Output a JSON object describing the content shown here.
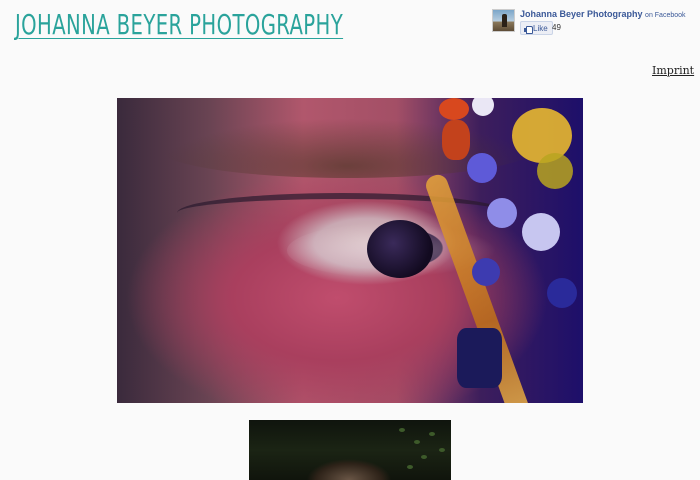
{
  "header": {
    "site_title": "Johanna Beyer Photography"
  },
  "facebook": {
    "page_name": "Johanna Beyer Photography",
    "suffix": "on Facebook",
    "like_label": "Like",
    "like_count": "49"
  },
  "nav": {
    "imprint": "Imprint"
  },
  "gallery": {
    "images": [
      {
        "name": "eye-closeup-photo"
      },
      {
        "name": "portrait-photo"
      }
    ]
  }
}
